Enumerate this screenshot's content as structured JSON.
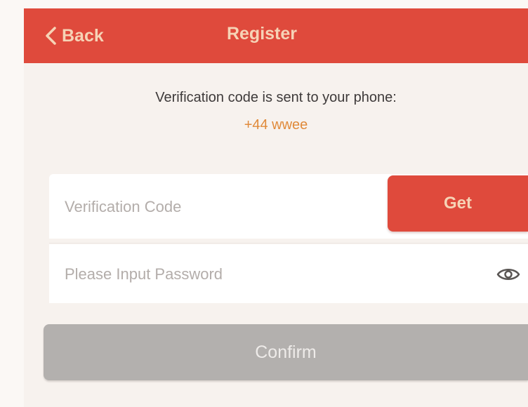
{
  "nav": {
    "back_label": "Back",
    "title": "Register"
  },
  "notice": {
    "text": "Verification code is sent to your phone:",
    "phone": "+44 wwee"
  },
  "form": {
    "code_placeholder": "Verification Code",
    "code_value": "",
    "get_label": "Get",
    "password_placeholder": "Please Input Password",
    "password_value": "",
    "confirm_label": "Confirm"
  },
  "icons": {
    "back": "chevron-left-icon",
    "password_toggle": "eye-icon"
  },
  "colors": {
    "accent": "#df4a3c",
    "accent_text": "#f6d3b6",
    "phone_text": "#e08a3a",
    "disabled_button": "#b3b0ae",
    "background": "#f7f2ee"
  }
}
